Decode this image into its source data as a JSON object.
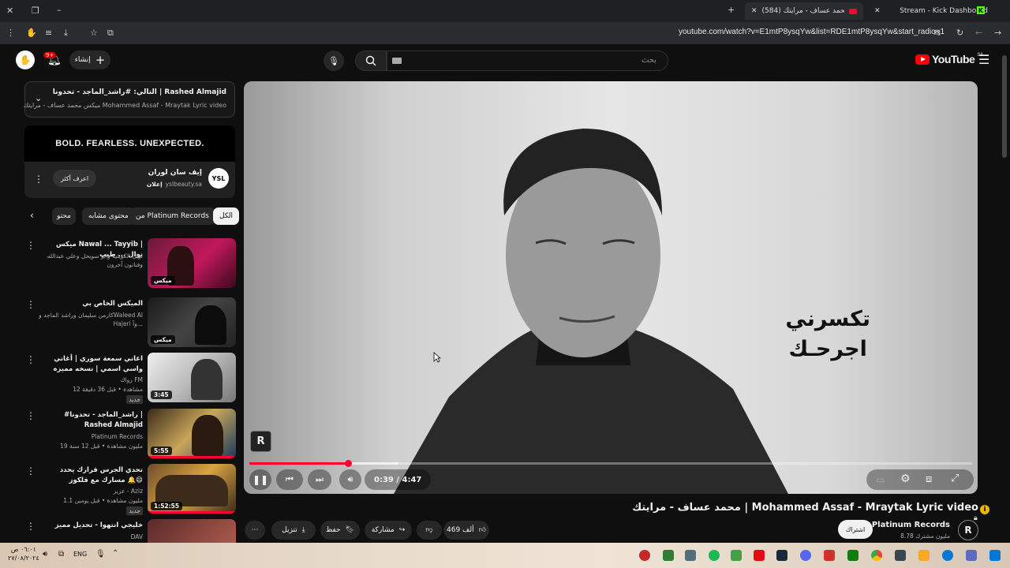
{
  "browser": {
    "tabs": [
      {
        "label": "Stream - Kick Dashboard"
      },
      {
        "label": "(584) محمد عساف - مرايتك"
      }
    ],
    "url": "youtube.com/watch?v=E1mtP8ysqYw&list=RDE1mtP8ysqYw&start_radio=1"
  },
  "header": {
    "logo_text": "YouTube",
    "logo_region": "SA",
    "search_placeholder": "بحث",
    "create_label": "إنشاء",
    "notifications_badge": "9+"
  },
  "playlist": {
    "next_label": "التالي: #راشد_الماجد - تحدونا | Rashed Almajid",
    "subtitle": "ميكس محمد عساف - مرايتك Mohammed Assaf - Mraytak Lyric video"
  },
  "ad": {
    "banner": "BOLD. FEARLESS. UNEXPECTED.",
    "advertiser": "إيف سان لوران",
    "sponsored": "إعلان",
    "domain": "yslbeauty.sa",
    "cta": "اعرف أكثر"
  },
  "chips": [
    "الكل",
    "من Platinum Records",
    "محتوى مشابه",
    "محتو"
  ],
  "recommendations": [
    {
      "title": "ميكس Nawal ... Tayyib | نوال ... طيب",
      "meta1": "نوال الكويتية وابو سويحل وعلي عبدالله وفنانون آخرون",
      "meta2": "",
      "badge": "ميكس",
      "new": false
    },
    {
      "title": "الميكس الخاص بي",
      "meta1": "كارمن سليمان وراشد الماجد وWaleed Al Hajeri وآ...",
      "meta2": "",
      "badge": "ميكس",
      "new": false
    },
    {
      "title": "اغاني سمعة سوري | أغاني واسي اسمي | نسخه مميزه",
      "meta1": "زواك FM",
      "meta2": "12 مشاهدة • قبل 36 دقيقة",
      "badge": "3:45",
      "new": true
    },
    {
      "title": "#راشد_الماجد - تحدونا | Rashed Almajid",
      "meta1": "Platinum Records",
      "meta2": "19 مليون مشاهدة • قبل 12 سنة",
      "badge": "5:55",
      "new": false
    },
    {
      "title": "تحدي الجرس قرارك يحدد مسارك مع فلكوز 🔔😄",
      "meta1": "عزيز - Aziz",
      "meta2": "1.1 مليون مشاهدة • قبل يومين",
      "badge": "1:52:55",
      "new": true
    },
    {
      "title": "خليجي انتهوا - تحديل مميز",
      "meta1": "DAV",
      "meta2": "",
      "badge": "",
      "new": false
    }
  ],
  "new_label": "جديد",
  "player": {
    "lyrics_line1": "تكسرني",
    "lyrics_line2": "اجرحـك",
    "time": "0:39 / 4:47",
    "progress": 0.136
  },
  "video": {
    "title": "محمد عساف - مرايتك | Mohammed Assaf - Mraytak Lyric video",
    "channel": "Platinum Records",
    "subscribers": "8.78 مليون مشترك",
    "subscribe_label": "اشتراك",
    "likes": "469 ألف",
    "share_label": "مشاركة",
    "save_label": "حفظ",
    "download_label": "تنزيل"
  },
  "taskbar": {
    "lang": "ENG",
    "time": "٠٦:٠١ ص",
    "date": "٢٧/٠٨/٢٠٢٤"
  }
}
